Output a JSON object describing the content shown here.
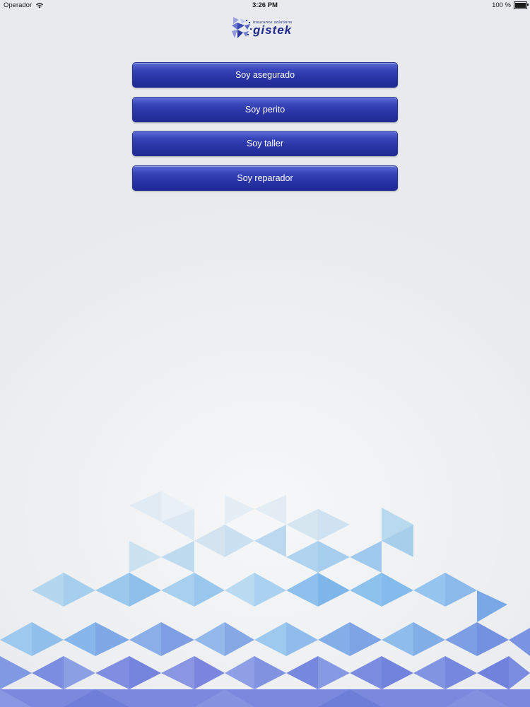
{
  "status_bar": {
    "carrier": "Operador",
    "time": "3:26 PM",
    "battery_text": "100 %",
    "battery_level": 1.0
  },
  "logo": {
    "tagline": "insurance solutions",
    "wordmark": "gistek",
    "color": "#1f2a8c"
  },
  "menu": {
    "buttons": [
      {
        "label": "Soy asegurado"
      },
      {
        "label": "Soy perito"
      },
      {
        "label": "Soy taller"
      },
      {
        "label": "Soy reparador"
      }
    ]
  },
  "colors": {
    "button_top": "#5b6ad6",
    "button_bottom": "#1f2a96",
    "background": "#eef0f2"
  }
}
